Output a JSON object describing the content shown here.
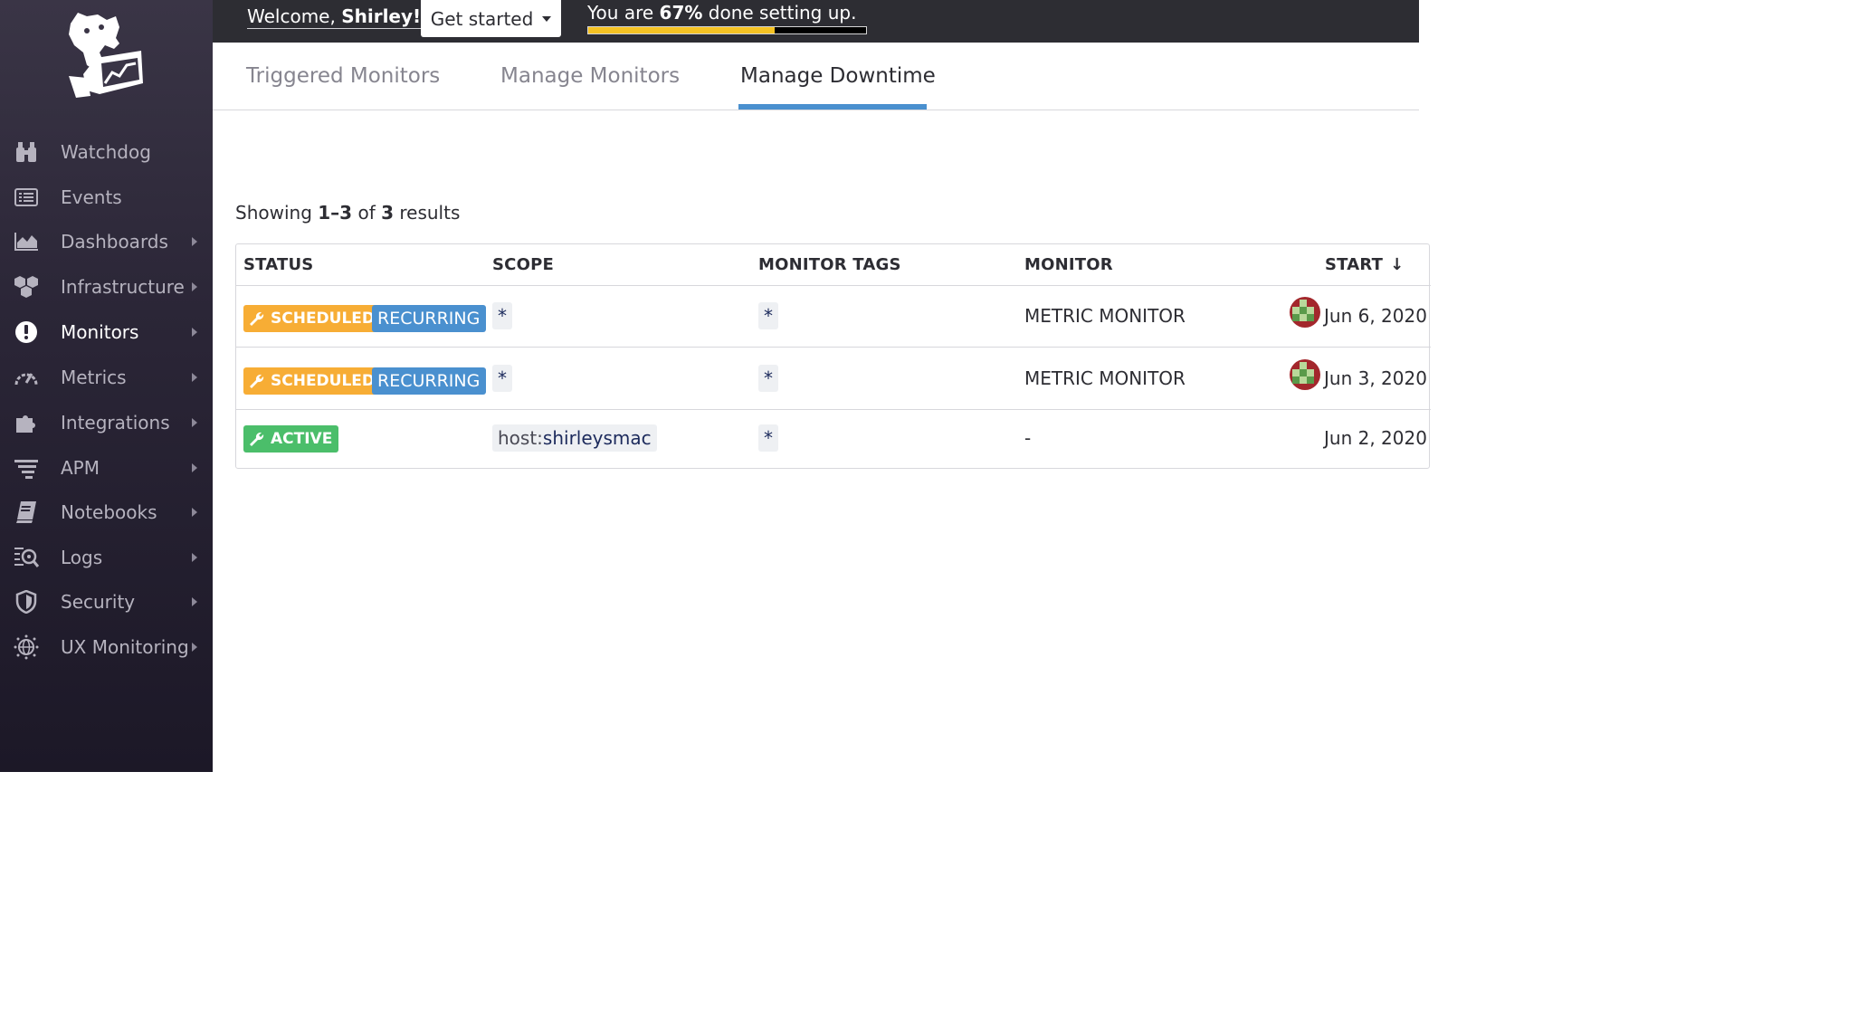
{
  "sidebar": {
    "logo": "datadog-logo",
    "items": [
      {
        "label": "Watchdog",
        "icon": "binoculars-icon",
        "caret": false,
        "active": false
      },
      {
        "label": "Events",
        "icon": "events-list-icon",
        "caret": false,
        "active": false
      },
      {
        "label": "Dashboards",
        "icon": "area-chart-icon",
        "caret": true,
        "active": false
      },
      {
        "label": "Infrastructure",
        "icon": "hexagons-icon",
        "caret": true,
        "active": false
      },
      {
        "label": "Monitors",
        "icon": "exclamation-circle-icon",
        "caret": true,
        "active": true
      },
      {
        "label": "Metrics",
        "icon": "gauge-icon",
        "caret": true,
        "active": false
      },
      {
        "label": "Integrations",
        "icon": "puzzle-icon",
        "caret": true,
        "active": false
      },
      {
        "label": "APM",
        "icon": "apm-lines-icon",
        "caret": true,
        "active": false
      },
      {
        "label": "Notebooks",
        "icon": "notebook-icon",
        "caret": true,
        "active": false
      },
      {
        "label": "Logs",
        "icon": "logs-icon",
        "caret": true,
        "active": false
      },
      {
        "label": "Security",
        "icon": "shield-icon",
        "caret": true,
        "active": false
      },
      {
        "label": "UX Monitoring",
        "icon": "globe-icon",
        "caret": true,
        "active": false
      }
    ]
  },
  "topbar": {
    "welcome_prefix": "Welcome, ",
    "welcome_name": "Shirley!",
    "get_started": "Get started",
    "progress_prefix": "You are ",
    "progress_percent": "67%",
    "progress_suffix": " done setting up.",
    "progress_value": 0.67,
    "accent": "#f5c223"
  },
  "tabs": [
    {
      "label": "Triggered Monitors",
      "active": false
    },
    {
      "label": "Manage Monitors",
      "active": false
    },
    {
      "label": "Manage Downtime",
      "active": true
    }
  ],
  "results": {
    "prefix": "Showing ",
    "range": "1–3",
    "of": " of ",
    "total": "3",
    "suffix": " results"
  },
  "table": {
    "headers": {
      "status": "STATUS",
      "scope": "SCOPE",
      "monitor_tags": "MONITOR TAGS",
      "monitor": "MONITOR",
      "start": "START",
      "sort_icon": "↓"
    },
    "rows": [
      {
        "status": "SCHEDULED",
        "recurring": "RECURRING",
        "scope": "*",
        "monitor_tags": "*",
        "monitor": "METRIC MONITOR",
        "start": "Jun 6, 2020",
        "has_avatar": true
      },
      {
        "status": "SCHEDULED",
        "recurring": "RECURRING",
        "scope": "*",
        "monitor_tags": "*",
        "monitor": "METRIC MONITOR",
        "start": "Jun 3, 2020",
        "has_avatar": true
      },
      {
        "status": "ACTIVE",
        "recurring": "",
        "scope_key": "host:",
        "scope_value": "shirleysmac",
        "monitor_tags": "*",
        "monitor": "-",
        "start": "Jun 2, 2020",
        "has_avatar": false
      }
    ]
  },
  "colors": {
    "scheduled": "#f7ad35",
    "active": "#4bbe6a",
    "recurring": "#4a90cf",
    "tab_underline": "#4a90cf"
  }
}
